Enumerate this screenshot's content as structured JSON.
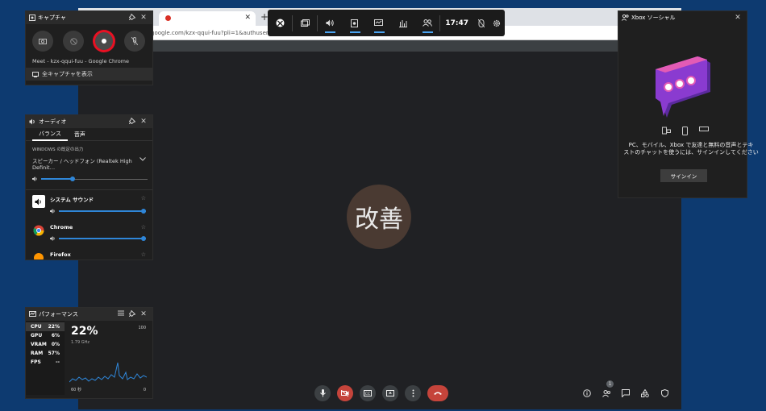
{
  "browser": {
    "url_text": "google.com/kzx-qqui-fuu?pli=1&authuser=0",
    "new_tab": "+",
    "tab_close": "✕"
  },
  "meet": {
    "avatar_text": "改善",
    "people_badge": "1",
    "colors": {
      "leave": "#c5443b",
      "avatar_bg": "#4a3a32"
    }
  },
  "gamebar": {
    "time": "17:47",
    "icons": [
      "xbox-icon",
      "widget-menu-icon",
      "audio-icon",
      "capture-icon",
      "performance-icon",
      "resources-icon",
      "social-icon",
      "mouse-icon",
      "settings-icon"
    ]
  },
  "capture": {
    "title": "キャプチャ",
    "source": "Meet - kzx-qqui-fuu - Google Chrome",
    "show_all": "全キャプチャを表示",
    "record_color": "#e81123"
  },
  "audio": {
    "title": "オーディオ",
    "tabs": [
      "バランス",
      "音声"
    ],
    "output_label": "WINDOWS の既定の出力",
    "device": "スピーカー / ヘッドフォン (Realtek High Definit…",
    "master_level": 0.3,
    "apps": [
      {
        "name": "システム サウンド",
        "level": 1.0
      },
      {
        "name": "Chrome",
        "level": 1.0
      },
      {
        "name": "Firefox",
        "level": 1.0
      }
    ],
    "accent": "#2f86d8"
  },
  "performance": {
    "title": "パフォーマンス",
    "rows": [
      {
        "label": "CPU",
        "value": "22%"
      },
      {
        "label": "GPU",
        "value": "6%"
      },
      {
        "label": "VRAM",
        "value": "0%"
      },
      {
        "label": "RAM",
        "value": "57%"
      },
      {
        "label": "FPS",
        "value": "--"
      }
    ],
    "big_value": "22%",
    "freq": "1.79 GHz",
    "scale_max": "100",
    "scale_min": "0",
    "time_span": "60 秒",
    "graph_color": "#2f86d8"
  },
  "social": {
    "title": "Xbox ソーシャル",
    "message_line1": "PC、モバイル、Xbox で友達と無料の音声とテキ",
    "message_line2": "ストのチャットを使うには、サインインしてください",
    "signin": "サインイン",
    "bubble_colors": [
      "#e040a0",
      "#7a3cc8"
    ]
  }
}
